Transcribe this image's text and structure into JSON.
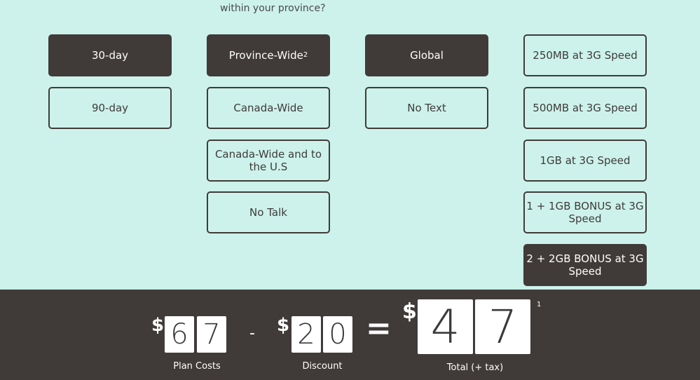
{
  "question_fragment": "within your province?",
  "columns": [
    {
      "options": [
        {
          "label": "30-day",
          "selected": true
        },
        {
          "label": "90-day",
          "selected": false
        }
      ]
    },
    {
      "options": [
        {
          "label": "Province-Wide",
          "sup": "2",
          "selected": true
        },
        {
          "label": "Canada-Wide",
          "selected": false
        },
        {
          "label": "Canada-Wide and to the U.S",
          "selected": false
        },
        {
          "label": "No Talk",
          "selected": false
        }
      ]
    },
    {
      "options": [
        {
          "label": "Global",
          "selected": true
        },
        {
          "label": "No Text",
          "selected": false
        }
      ]
    },
    {
      "options": [
        {
          "label": "250MB at 3G Speed",
          "selected": false
        },
        {
          "label": "500MB at 3G Speed",
          "selected": false
        },
        {
          "label": "1GB at 3G Speed",
          "selected": false
        },
        {
          "label": "1 + 1GB BONUS at 3G Speed",
          "selected": false
        },
        {
          "label": "2 + 2GB BONUS at 3G Speed",
          "selected": true
        }
      ]
    }
  ],
  "summary": {
    "currency": "$",
    "plan_cost_digits": [
      "6",
      "7"
    ],
    "plan_cost_label": "Plan Costs",
    "minus": "-",
    "discount_digits": [
      "2",
      "0"
    ],
    "discount_label": "Discount",
    "equals": "=",
    "total_digits": [
      "4",
      "7"
    ],
    "total_label": "Total (+ tax)",
    "footnote": "1"
  },
  "colors": {
    "background": "#ccf2eb",
    "dark": "#403b38"
  }
}
